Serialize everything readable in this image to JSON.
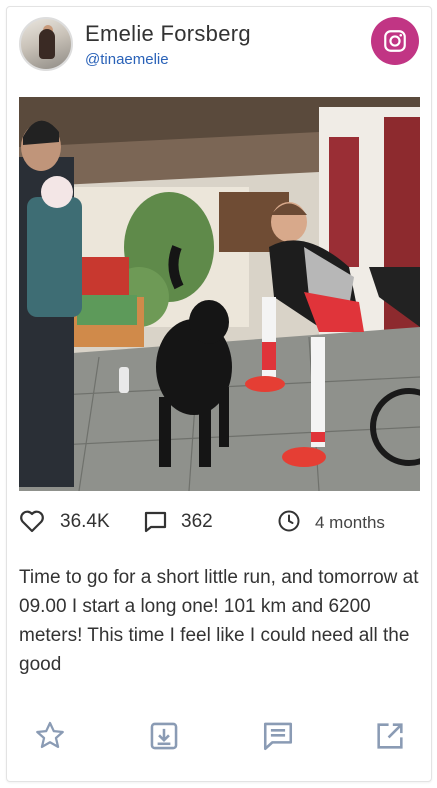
{
  "post": {
    "author_name": "Emelie Forsberg",
    "author_handle": "@tinaemelie",
    "platform_icon": "instagram-icon",
    "likes": "36.4K",
    "comments": "362",
    "age": "4 months",
    "caption": "Time to go for a short little run, and tomorrow at 09.00 I start a long one! 101 km and 6200 meters! This time I feel like I could need all the good"
  },
  "icons": {
    "like": "heart-icon",
    "comment": "comment-icon",
    "time": "clock-icon",
    "favorite": "star-icon",
    "download": "download-icon",
    "reply": "message-icon",
    "open": "external-link-icon"
  },
  "colors": {
    "instagram_brand": "#c13584",
    "handle_link": "#2a62b8",
    "action_icon": "#8a9bb4"
  }
}
